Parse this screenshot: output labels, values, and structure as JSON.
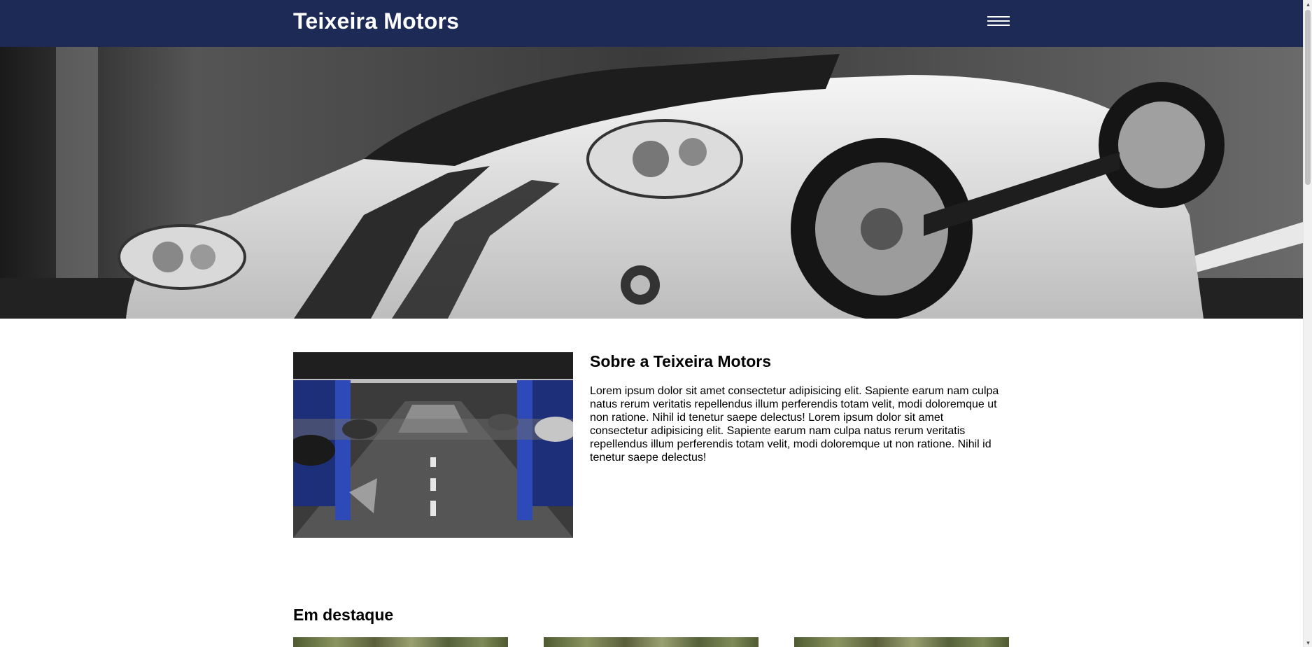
{
  "header": {
    "brand": "Teixeira Motors",
    "menu_icon": "hamburger-menu-icon",
    "background": "#1c2a55"
  },
  "hero": {
    "image": "white-sports-car-photo"
  },
  "about": {
    "image": "parking-garage-photo",
    "title": "Sobre a Teixeira Motors",
    "paragraph": "Lorem ipsum dolor sit amet consectetur adipisicing elit. Sapiente earum nam culpa natus rerum veritatis repellendus illum perferendis totam velit, modi doloremque ut non ratione. Nihil id tenetur saepe delectus! Lorem ipsum dolor sit amet consectetur adipisicing elit. Sapiente earum nam culpa natus rerum veritatis repellendus illum perferendis totam velit, modi doloremque ut non ratione. Nihil id tenetur saepe delectus!"
  },
  "featured": {
    "title": "Em destaque",
    "cards": [
      {
        "image": "featured-car-photo"
      },
      {
        "image": "featured-car-photo"
      },
      {
        "image": "featured-car-photo"
      }
    ]
  },
  "scrollbar": {
    "up_icon": "scroll-up-arrow-icon",
    "down_icon": "scroll-down-arrow-icon"
  }
}
